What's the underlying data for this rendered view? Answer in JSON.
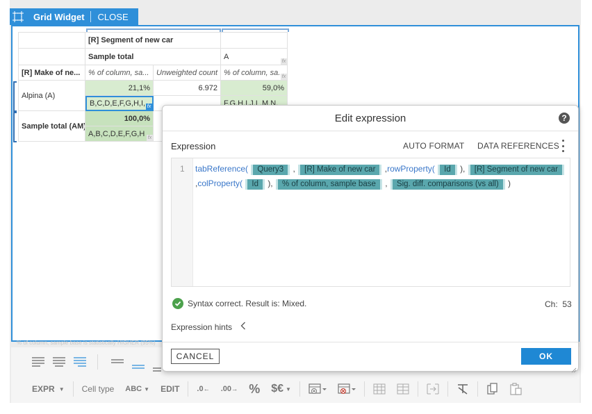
{
  "widget": {
    "title": "Grid Widget",
    "close_label": "CLOSE"
  },
  "grid": {
    "col_header_top": "[R] Segment of new car",
    "col_sub_a": "Sample total",
    "col_sub_b": "A",
    "row_header_label": "[R] Make of ne...",
    "measures": [
      "% of column, sa...",
      "Unweighted count",
      "% of column, sa..."
    ],
    "rows": [
      {
        "label": "Alpina (A)",
        "v1": "21,1%",
        "v2": "6.972",
        "v3": "59,0%",
        "sig1": "B,C,D,E,F,G,H,I,",
        "sig3": "F,G,H,I,J,L,M,N,"
      },
      {
        "label": "Sample total (AM)",
        "v1": "100,0%",
        "sig1": "A,B,C,D,E,F,G,H"
      }
    ],
    "fx": "fx",
    "footer_note": "% of column, sample base is statistically HIGHER (95%)"
  },
  "toolbar": {
    "expr": "EXPR",
    "cell_type": "Cell type",
    "abc": "ABC",
    "edit": "EDIT",
    "percent": "%",
    "currency": "$€"
  },
  "modal": {
    "title": "Edit expression",
    "help": "?",
    "section": "Expression",
    "auto_format": "AUTO FORMAT",
    "data_references": "DATA REFERENCES",
    "line_number": "1",
    "code": {
      "fn1": "tabReference(",
      "t1": "Query3",
      "comma": ",",
      "t2": "[R] Make of new car",
      "fn2": "rowProperty(",
      "t3": "Id",
      "close_comma": "),",
      "t4": "[R] Segment of new car",
      "fn3": "colProperty(",
      "t5": "Id",
      "t6": "% of column, sample base",
      "t7": "Sig. diff. comparisons (vs all)",
      "end": ")"
    },
    "status": "Syntax correct. Result is: Mixed.",
    "ch_label": "Ch:",
    "ch_value": "53",
    "hints": "Expression hints",
    "cancel": "CANCEL",
    "ok": "OK"
  }
}
